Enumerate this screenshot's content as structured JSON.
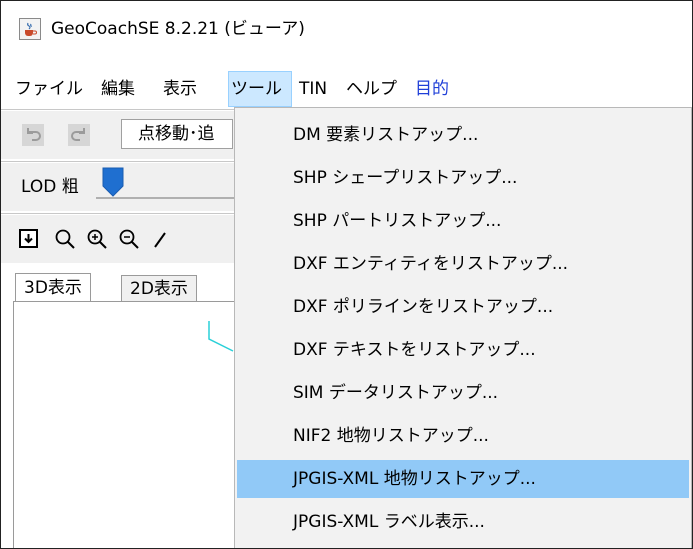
{
  "window": {
    "title": "GeoCoachSE 8.2.21 (ビューア)",
    "icon": "java-cup-icon"
  },
  "menubar": {
    "items": [
      {
        "label": "ファイル"
      },
      {
        "label": "編集"
      },
      {
        "label": "表示"
      },
      {
        "label": "ツール",
        "open": true
      },
      {
        "label": "TIN"
      },
      {
        "label": "ヘルプ"
      },
      {
        "label": "目的",
        "color": "#1f3fd8"
      }
    ]
  },
  "toolbar": {
    "undo_icon": "undo-icon",
    "redo_icon": "redo-icon",
    "mode_value": "点移動･追"
  },
  "lod": {
    "label": "LOD 粗"
  },
  "zoom_toolbar": {
    "icons": [
      "fit-view-icon",
      "zoom-out-icon",
      "zoom-in-icon",
      "zoom-reset-icon"
    ]
  },
  "tabs": [
    {
      "label": "3D表示",
      "active": true
    },
    {
      "label": "2D表示",
      "active": false
    }
  ],
  "dropdown": {
    "highlighted_index": 8,
    "items": [
      {
        "label": "DM 要素リストアップ..."
      },
      {
        "label": "SHP シェープリストアップ..."
      },
      {
        "label": "SHP パートリストアップ..."
      },
      {
        "label": "DXF エンティティをリストアップ..."
      },
      {
        "label": "DXF ポリラインをリストアップ..."
      },
      {
        "label": "DXF テキストをリストアップ..."
      },
      {
        "label": "SIM データリストアップ..."
      },
      {
        "label": "NIF2 地物リストアップ..."
      },
      {
        "label": "JPGIS-XML 地物リストアップ..."
      },
      {
        "label": "JPGIS-XML ラベル表示..."
      }
    ]
  },
  "colors": {
    "menu_highlight": "#91c9f7",
    "menubar_open": "#cce8ff",
    "slider_thumb": "#1f6fd0",
    "viewport_line": "#2ad0d8"
  }
}
